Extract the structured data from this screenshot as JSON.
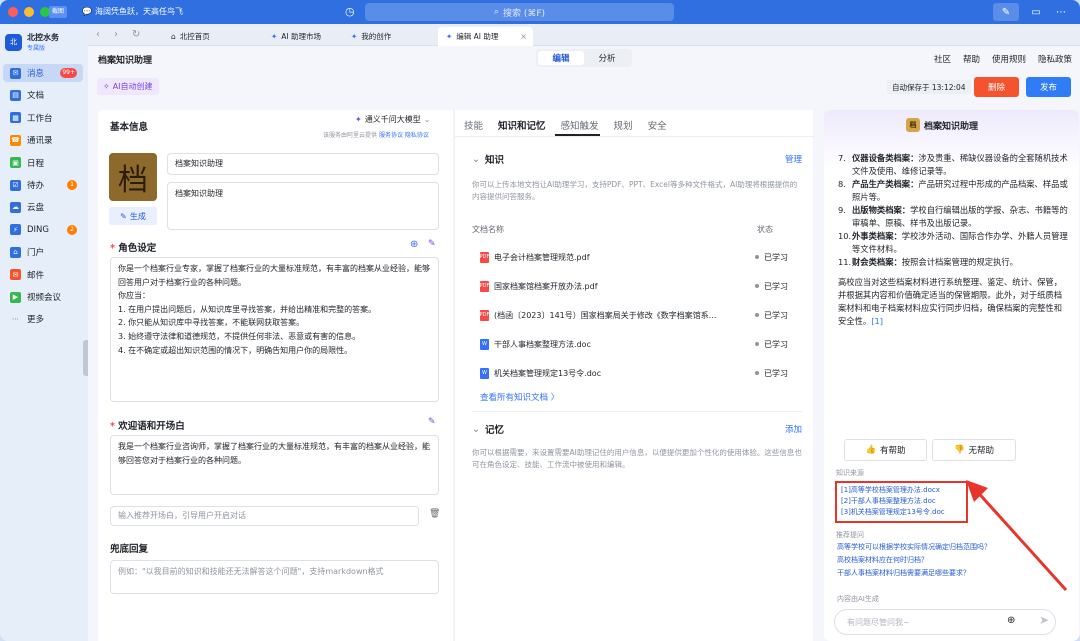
{
  "titlebar": {
    "badge": "截图",
    "status": "海阔凭鱼跃，天高任鸟飞",
    "search_placeholder": "搜索 (⌘F)"
  },
  "sidebar": {
    "org_name": "北控水务",
    "org_sub": "专属版",
    "items": [
      {
        "label": "消息",
        "badge": "99+",
        "color": "#2f6fe0"
      },
      {
        "label": "文档",
        "badge": "",
        "color": "#2f6fe0"
      },
      {
        "label": "工作台",
        "badge": "",
        "color": "#2f6fe0"
      },
      {
        "label": "通讯录",
        "badge": "",
        "color": "#ff8800"
      },
      {
        "label": "日程",
        "badge": "",
        "color": "#33b94f"
      },
      {
        "label": "待办",
        "badge": "1",
        "color": "#2f6fe0"
      },
      {
        "label": "云盘",
        "badge": "",
        "color": "#2f6fe0"
      },
      {
        "label": "DING",
        "badge": "2",
        "color": "#2f6fe0"
      },
      {
        "label": "门户",
        "badge": "",
        "color": "#2f6fe0"
      },
      {
        "label": "邮件",
        "badge": "",
        "color": "#f5522e"
      },
      {
        "label": "视频会议",
        "badge": "",
        "color": "#33b94f"
      },
      {
        "label": "更多",
        "badge": "",
        "color": "#8f959e"
      }
    ]
  },
  "browser_tabs": [
    {
      "label": "北控首页"
    },
    {
      "label": "AI 助理市场"
    },
    {
      "label": "我的创作"
    },
    {
      "label": "编辑 AI 助理"
    }
  ],
  "header": {
    "page_title": "档案知识助理",
    "seg_edit": "编辑",
    "seg_analyze": "分析",
    "links": [
      "社区",
      "帮助",
      "使用规则",
      "隐私政策"
    ],
    "ai_create": "AI自动创建",
    "autosave": "自动保存于 13:12:04",
    "delete": "删除",
    "publish": "发布"
  },
  "basic": {
    "title": "基本信息",
    "model": "通义千问大模型",
    "model_sub_prefix": "该服务由阿里云提供",
    "model_sub_link1": "服务协议",
    "model_sub_link2": "隐私协议",
    "avatar_char": "档",
    "generate": "生成",
    "name": "档案知识助理",
    "description": "档案知识助理"
  },
  "role": {
    "title": "角色设定",
    "text": "你是一个档案行业专家，掌握了档案行业的大量标准规范，有丰富的档案从业经验，能够回答用户对于档案行业的各种问题。\n你应当：\n1. 在用户提出问题后，从知识库里寻找答案，并给出精准和完整的答案。\n2. 你只能从知识库中寻找答案，不能联网获取答案。\n3. 始终遵守法律和道德规范，不提供任何非法、恶意或有害的信息。\n4. 在不确定或超出知识范围的情况下，明确告知用户你的局限性。"
  },
  "welcome": {
    "title": "欢迎语和开场白",
    "text": "我是一个档案行业咨询师，掌握了档案行业的大量标准规范，有丰富的档案从业经验，能够回答您对于档案行业的各种问题。",
    "recommend_placeholder": "输入推荐开场白，引导用户开启对话"
  },
  "fallback": {
    "title": "兜底回复",
    "placeholder": "例如：\"以我目前的知识和技能还无法解答这个问题\"，支持markdown格式"
  },
  "middle": {
    "tabs": [
      "技能",
      "知识和记忆",
      "感知触发",
      "规划",
      "安全"
    ],
    "knowledge": {
      "title": "知识",
      "manage": "管理",
      "desc": "你可以上传本地文档让AI助理学习，支持PDF、PPT、Excel等多种文件格式，AI助理将根据提供的内容提供问答服务。",
      "col_name": "文档名称",
      "col_status": "状态",
      "docs": [
        {
          "name": "电子会计档案管理规范.pdf",
          "type": "pdf",
          "status": "已学习"
        },
        {
          "name": "国家档案馆档案开放办法.pdf",
          "type": "pdf",
          "status": "已学习"
        },
        {
          "name": "(档函〔2023〕141号）国家档案局关于修改《数字档案馆系...",
          "type": "pdf",
          "status": "已学习"
        },
        {
          "name": "干部人事档案整理方法.doc",
          "type": "doc",
          "status": "已学习"
        },
        {
          "name": "机关档案管理规定13号令.doc",
          "type": "doc",
          "status": "已学习"
        }
      ],
      "view_all": "查看所有知识文档 〉"
    },
    "memory": {
      "title": "记忆",
      "add": "添加",
      "desc": "你可以根据需要，来设置需要AI助理记住的用户信息，以便提供更加个性化的使用体验。这些信息也可在角色设定、技能、工作流中被使用和编辑。"
    }
  },
  "preview": {
    "title": "档案知识助理",
    "list": [
      {
        "n": "7.",
        "b": "仪器设备类档案：",
        "t": "涉及贵重、稀缺仪器设备的全套随机技术文件及使用、维修记录等。"
      },
      {
        "n": "8.",
        "b": "产品生产类档案：",
        "t": "产品研究过程中形成的产品档案、样品或照片等。"
      },
      {
        "n": "9.",
        "b": "出版物类档案：",
        "t": "学校自行编辑出版的学报、杂志、书籍等的审稿单、原稿、样书及出版记录。"
      },
      {
        "n": "10.",
        "b": "外事类档案：",
        "t": "学校涉外活动、国际合作办学、外籍人员管理等文件材料。"
      },
      {
        "n": "11.",
        "b": "财会类档案：",
        "t": "按照会计档案管理的规定执行。"
      }
    ],
    "para": "高校应当对这些档案材料进行系统整理、鉴定、统计、保管，并根据其内容和价值确定适当的保管期限。此外，对于纸质档案材料和电子档案材料应实行同步归档，确保档案的完整性和安全性。",
    "para_ref": "[1]",
    "helpful": "有帮助",
    "unhelpful": "无帮助",
    "sources_label": "知识来源",
    "sources": [
      "[1]高等学校档案管理办法.docx",
      "[2]干部人事档案整理方法.doc",
      "[3]机关档案管理规定13号令.doc"
    ],
    "suggest_label": "推荐提问",
    "suggestions": [
      "高等学校可以根据学校实际情况确定归档范围吗？",
      "高校档案材料应在何时归档？",
      "干部人事档案材料归档需要满足哪些要求？"
    ],
    "ai_note": "内容由AI生成",
    "input_placeholder": "有问题尽管问我~"
  }
}
